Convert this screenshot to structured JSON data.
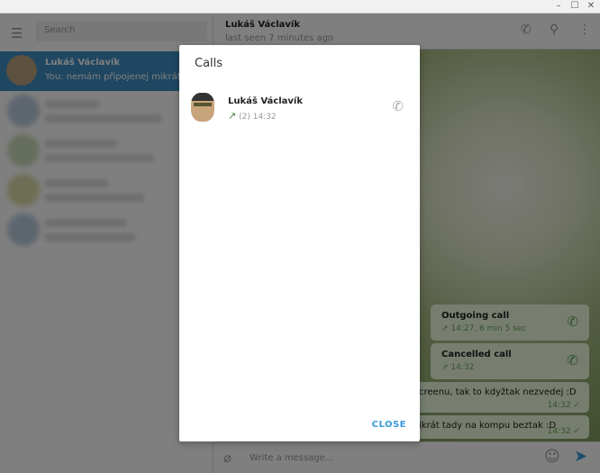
{
  "window": {
    "controls": [
      "–",
      "☐",
      "✕"
    ]
  },
  "sidebar": {
    "search_placeholder": "Search",
    "selected_chat": {
      "name": "Lukáš Václavík",
      "preview": "You: nemám připojenej mikrát tady na kompu beztak :D"
    }
  },
  "chat": {
    "header": {
      "name": "Lukáš Václavík",
      "status": "last seen 7 minutes ago"
    },
    "messages": [
      {
        "type": "call",
        "title": "Outgoing call",
        "detail": "14:27, 6 min 5 sec"
      },
      {
        "type": "call",
        "title": "Cancelled call",
        "detail": "14:32"
      },
      {
        "type": "text",
        "text": "creenu, tak to kdyžtak nezvedej :D",
        "time": "14:32"
      },
      {
        "type": "text",
        "text": "ikrát tady na kompu beztak :D",
        "time": "14:32"
      }
    ],
    "input_placeholder": "Write a message..."
  },
  "dialog": {
    "title": "Calls",
    "calls": [
      {
        "name": "Lukáš Václavík",
        "count": "(2)",
        "time": "14:32"
      }
    ],
    "close_label": "CLOSE"
  },
  "colors": {
    "accent": "#3a9ad9",
    "selected_chat": "#3f8fc5",
    "bubble": "#effdde"
  }
}
